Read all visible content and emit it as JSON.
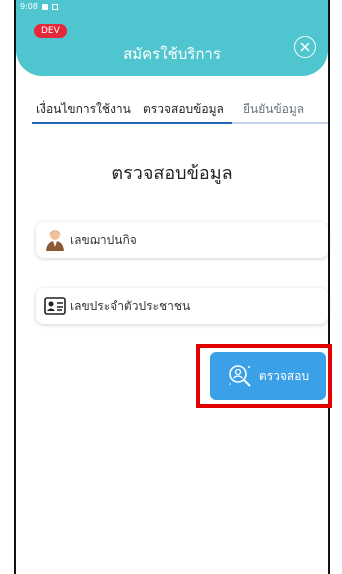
{
  "status_bar": {
    "time": "9:08"
  },
  "header": {
    "badge": "DEV",
    "title": "สมัครใช้บริการ"
  },
  "tabs": [
    {
      "label": "เงื่อนไขการใช้งาน"
    },
    {
      "label": "ตรวจสอบข้อมูล"
    },
    {
      "label": "ยืนยันข้อมูล"
    }
  ],
  "section_title": "ตรวจสอบข้อมูล",
  "fields": [
    {
      "label": "เลขฌาปนกิจ",
      "icon": "person-icon"
    },
    {
      "label": "เลขประจำตัวประชาชน",
      "icon": "id-card-icon"
    }
  ],
  "verify_button": {
    "label": "ตรวจสอบ",
    "icon": "search-user-icon"
  },
  "colors": {
    "header": "#4fc6cf",
    "badge": "#e5283a",
    "button": "#3aa0e8",
    "tab_active": "#2466b8",
    "highlight": "#e00000"
  }
}
